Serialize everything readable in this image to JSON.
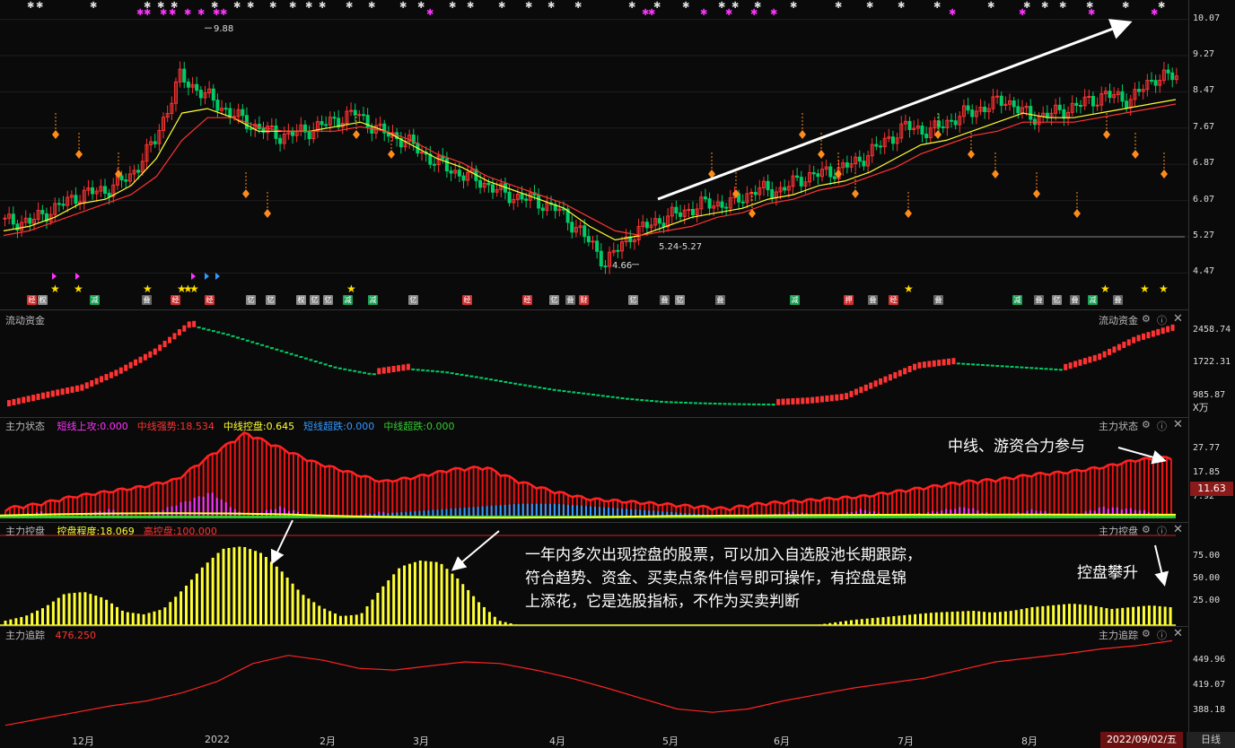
{
  "main": {
    "price_ticks": [
      "10.07",
      "9.27",
      "8.47",
      "7.67",
      "6.87",
      "6.07",
      "5.27",
      "4.47"
    ],
    "high_label": "9.88",
    "low_label": "4.66",
    "zone_label": "5.24-5.27"
  },
  "liquidity": {
    "title": "流动资金",
    "title_right": "流动资金",
    "ticks": [
      "2458.74",
      "1722.31",
      "985.87"
    ],
    "unit": "X万"
  },
  "state": {
    "title": "主力状态",
    "title_right": "主力状态",
    "legend": [
      {
        "label": "短线上攻:0.000",
        "color": "#ff33ff"
      },
      {
        "label": "中线强势:18.534",
        "color": "#ff3333"
      },
      {
        "label": "中线控盘:0.645",
        "color": "#ffff33"
      },
      {
        "label": "短线超跌:0.000",
        "color": "#3399ff"
      },
      {
        "label": "中线超跌:0.000",
        "color": "#33cc33"
      }
    ],
    "ticks": [
      "27.77",
      "17.85",
      "7.92"
    ],
    "current": "11.63"
  },
  "control": {
    "title": "主力控盘",
    "title_right": "主力控盘",
    "legend": [
      {
        "label": "控盘程度:18.069",
        "color": "#ffff33"
      },
      {
        "label": "高控盘:100.000",
        "color": "#ff3333"
      }
    ],
    "ticks": [
      "75.00",
      "50.00",
      "25.00"
    ]
  },
  "track": {
    "title": "主力追踪",
    "title_right": "主力追踪",
    "value": "476.250",
    "ticks": [
      "449.96",
      "419.07",
      "388.18"
    ]
  },
  "annotations": {
    "a1": "中线、游资合力参与",
    "a2_line1": "一年内多次出现控盘的股票，可以加入自选股池长期跟踪，",
    "a2_line2": "符合趋势、资金、买卖点条件信号即可操作，有控盘是锦",
    "a2_line3": "上添花，它是选股指标，不作为买卖判断",
    "a3": "控盘攀升"
  },
  "x_axis": {
    "labels": [
      "12月",
      "2022",
      "2月",
      "3月",
      "4月",
      "5月",
      "6月",
      "7月",
      "8月"
    ],
    "date_badge": "2022/09/02/五",
    "period": "日线"
  },
  "tags": [
    "经",
    "权",
    "减",
    "叠",
    "经",
    "经",
    "亿",
    "亿",
    "权",
    "亿",
    "亿",
    "减",
    "减",
    "亿",
    "经",
    "经",
    "亿",
    "叠",
    "财",
    "亿",
    "叠",
    "亿",
    "叠",
    "减",
    "押",
    "叠",
    "经",
    "叠",
    "减",
    "叠",
    "亿",
    "叠",
    "减",
    "叠"
  ],
  "colors": {
    "up": "#ff3333",
    "down": "#00cc66",
    "ma_fast": "#ffff33",
    "ma_slow": "#ff3333",
    "diamond": "#ff8c1a",
    "track_line": "#ff2222"
  },
  "chart_data": [
    {
      "type": "line",
      "title": "",
      "y_ticks": [
        10.07,
        9.27,
        8.47,
        7.67,
        6.87,
        6.07,
        5.27,
        4.47
      ],
      "ylim": [
        4.2,
        10.3
      ],
      "x_labels": [
        "12月",
        "2022",
        "2月",
        "3月",
        "4月",
        "5月",
        "6月",
        "7月",
        "8月"
      ],
      "series": [
        {
          "values": [
            5.6,
            5.6,
            5.9,
            6.2,
            6.3,
            6.6,
            7.4,
            8.8,
            8.4,
            8.0,
            7.7,
            7.5,
            7.6,
            7.8,
            8.0,
            7.6,
            7.4,
            7.0,
            6.7,
            6.5,
            6.2,
            6.1,
            5.9,
            5.4,
            4.7,
            5.3,
            5.6,
            5.8,
            6.0,
            6.0,
            6.3,
            6.3,
            6.6,
            6.7,
            6.9,
            7.3,
            7.7,
            7.6,
            7.9,
            8.1,
            8.3,
            7.9,
            8.0,
            8.2,
            8.4,
            8.3,
            8.8
          ]
        },
        {
          "values": [
            5.4,
            5.5,
            5.7,
            6.0,
            6.1,
            6.4,
            7.0,
            8.0,
            8.1,
            7.9,
            7.6,
            7.6,
            7.6,
            7.7,
            7.8,
            7.6,
            7.3,
            7.0,
            6.8,
            6.5,
            6.3,
            6.1,
            5.9,
            5.5,
            5.2,
            5.3,
            5.5,
            5.7,
            5.8,
            5.9,
            6.1,
            6.2,
            6.4,
            6.5,
            6.7,
            7.0,
            7.3,
            7.4,
            7.6,
            7.8,
            8.0,
            7.9,
            7.9,
            8.0,
            8.1,
            8.2,
            8.3
          ]
        },
        {
          "values": [
            5.3,
            5.4,
            5.6,
            5.8,
            6.0,
            6.2,
            6.6,
            7.4,
            7.9,
            7.9,
            7.7,
            7.6,
            7.6,
            7.6,
            7.7,
            7.6,
            7.4,
            7.1,
            6.9,
            6.6,
            6.4,
            6.2,
            6.0,
            5.7,
            5.4,
            5.3,
            5.4,
            5.5,
            5.7,
            5.8,
            6.0,
            6.1,
            6.3,
            6.4,
            6.6,
            6.8,
            7.1,
            7.3,
            7.5,
            7.6,
            7.8,
            7.8,
            7.8,
            7.9,
            8.0,
            8.1,
            8.2
          ]
        }
      ],
      "annotations": [
        "9.88",
        "4.66",
        "5.24-5.27"
      ]
    },
    {
      "type": "bar",
      "title": "流动资金",
      "y_ticks": [
        2458.74,
        1722.31,
        985.87
      ],
      "unit": "X万",
      "values": [
        800,
        980,
        1150,
        1500,
        1950,
        2600,
        2400,
        2150,
        1900,
        1650,
        1500,
        1620,
        1550,
        1420,
        1280,
        1150,
        1050,
        950,
        880,
        850,
        830,
        820,
        860,
        950,
        1300,
        1650,
        1750,
        1700,
        1650,
        1600,
        1850,
        2250,
        2500
      ]
    },
    {
      "type": "bar",
      "title": "主力状态",
      "y_ticks": [
        27.77,
        17.85,
        7.92
      ],
      "series": [
        {
          "name": "中线强势",
          "values": [
            3,
            5,
            8,
            10,
            12,
            15,
            25,
            34,
            28,
            22,
            18,
            14,
            16,
            19,
            20,
            14,
            10,
            7,
            6,
            5,
            4,
            3,
            5,
            6,
            7,
            8,
            10,
            12,
            14,
            15,
            17,
            18,
            20,
            23,
            24
          ]
        },
        {
          "name": "短线上攻",
          "values": [
            0,
            2,
            0,
            3,
            0,
            5,
            10,
            0,
            4,
            0,
            0,
            2,
            0,
            3,
            0,
            0,
            0,
            0,
            0,
            0,
            0,
            0,
            0,
            2,
            0,
            3,
            0,
            2,
            4,
            0,
            3,
            0,
            4,
            3,
            0
          ]
        },
        {
          "name": "短线超跌",
          "values": [
            0,
            0,
            0,
            0,
            0,
            0,
            0,
            0,
            0,
            0,
            0,
            1,
            2,
            3,
            4,
            5,
            5,
            4,
            3,
            2,
            1,
            0,
            0,
            0,
            0,
            0,
            0,
            0,
            0,
            0,
            0,
            0,
            0,
            0,
            0
          ]
        }
      ],
      "current": 11.63
    },
    {
      "type": "bar",
      "title": "主力控盘",
      "y_ticks": [
        75.0,
        50.0,
        25.0
      ],
      "series": [
        {
          "name": "控盘程度",
          "values": [
            5,
            10,
            20,
            35,
            37,
            30,
            15,
            12,
            18,
            40,
            65,
            85,
            88,
            80,
            60,
            35,
            20,
            10,
            12,
            40,
            65,
            72,
            70,
            50,
            25,
            5,
            0,
            0,
            0,
            0,
            0,
            0,
            0,
            0,
            0,
            0,
            0,
            0,
            0,
            0,
            0,
            0,
            3,
            6,
            8,
            10,
            12,
            14,
            15,
            16,
            14,
            16,
            20,
            22,
            24,
            22,
            18,
            20,
            22,
            20
          ]
        }
      ]
    },
    {
      "type": "line",
      "title": "主力追踪",
      "y_ticks": [
        449.96,
        419.07,
        388.18
      ],
      "series": [
        {
          "name": "主力追踪",
          "values": [
            372,
            380,
            388,
            396,
            402,
            412,
            426,
            448,
            458,
            452,
            442,
            440,
            445,
            450,
            448,
            440,
            430,
            418,
            405,
            392,
            388,
            392,
            402,
            410,
            418,
            424,
            430,
            440,
            450,
            455,
            460,
            466,
            470,
            476
          ]
        }
      ]
    }
  ]
}
